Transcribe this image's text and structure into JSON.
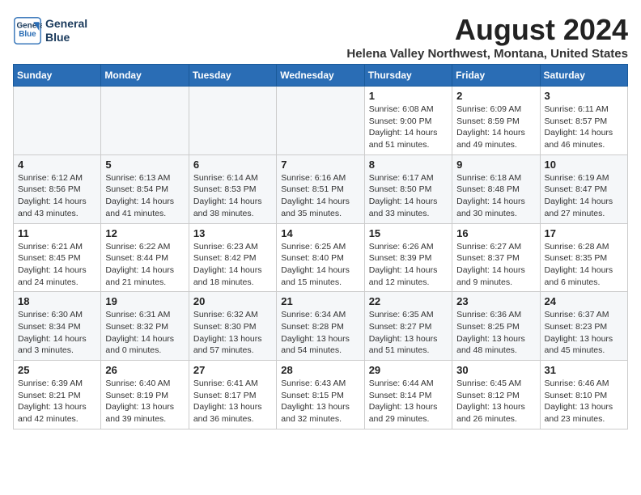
{
  "header": {
    "logo_line1": "General",
    "logo_line2": "Blue",
    "month_year": "August 2024",
    "location": "Helena Valley Northwest, Montana, United States"
  },
  "weekdays": [
    "Sunday",
    "Monday",
    "Tuesday",
    "Wednesday",
    "Thursday",
    "Friday",
    "Saturday"
  ],
  "weeks": [
    [
      {
        "day": "",
        "detail": ""
      },
      {
        "day": "",
        "detail": ""
      },
      {
        "day": "",
        "detail": ""
      },
      {
        "day": "",
        "detail": ""
      },
      {
        "day": "1",
        "detail": "Sunrise: 6:08 AM\nSunset: 9:00 PM\nDaylight: 14 hours\nand 51 minutes."
      },
      {
        "day": "2",
        "detail": "Sunrise: 6:09 AM\nSunset: 8:59 PM\nDaylight: 14 hours\nand 49 minutes."
      },
      {
        "day": "3",
        "detail": "Sunrise: 6:11 AM\nSunset: 8:57 PM\nDaylight: 14 hours\nand 46 minutes."
      }
    ],
    [
      {
        "day": "4",
        "detail": "Sunrise: 6:12 AM\nSunset: 8:56 PM\nDaylight: 14 hours\nand 43 minutes."
      },
      {
        "day": "5",
        "detail": "Sunrise: 6:13 AM\nSunset: 8:54 PM\nDaylight: 14 hours\nand 41 minutes."
      },
      {
        "day": "6",
        "detail": "Sunrise: 6:14 AM\nSunset: 8:53 PM\nDaylight: 14 hours\nand 38 minutes."
      },
      {
        "day": "7",
        "detail": "Sunrise: 6:16 AM\nSunset: 8:51 PM\nDaylight: 14 hours\nand 35 minutes."
      },
      {
        "day": "8",
        "detail": "Sunrise: 6:17 AM\nSunset: 8:50 PM\nDaylight: 14 hours\nand 33 minutes."
      },
      {
        "day": "9",
        "detail": "Sunrise: 6:18 AM\nSunset: 8:48 PM\nDaylight: 14 hours\nand 30 minutes."
      },
      {
        "day": "10",
        "detail": "Sunrise: 6:19 AM\nSunset: 8:47 PM\nDaylight: 14 hours\nand 27 minutes."
      }
    ],
    [
      {
        "day": "11",
        "detail": "Sunrise: 6:21 AM\nSunset: 8:45 PM\nDaylight: 14 hours\nand 24 minutes."
      },
      {
        "day": "12",
        "detail": "Sunrise: 6:22 AM\nSunset: 8:44 PM\nDaylight: 14 hours\nand 21 minutes."
      },
      {
        "day": "13",
        "detail": "Sunrise: 6:23 AM\nSunset: 8:42 PM\nDaylight: 14 hours\nand 18 minutes."
      },
      {
        "day": "14",
        "detail": "Sunrise: 6:25 AM\nSunset: 8:40 PM\nDaylight: 14 hours\nand 15 minutes."
      },
      {
        "day": "15",
        "detail": "Sunrise: 6:26 AM\nSunset: 8:39 PM\nDaylight: 14 hours\nand 12 minutes."
      },
      {
        "day": "16",
        "detail": "Sunrise: 6:27 AM\nSunset: 8:37 PM\nDaylight: 14 hours\nand 9 minutes."
      },
      {
        "day": "17",
        "detail": "Sunrise: 6:28 AM\nSunset: 8:35 PM\nDaylight: 14 hours\nand 6 minutes."
      }
    ],
    [
      {
        "day": "18",
        "detail": "Sunrise: 6:30 AM\nSunset: 8:34 PM\nDaylight: 14 hours\nand 3 minutes."
      },
      {
        "day": "19",
        "detail": "Sunrise: 6:31 AM\nSunset: 8:32 PM\nDaylight: 14 hours\nand 0 minutes."
      },
      {
        "day": "20",
        "detail": "Sunrise: 6:32 AM\nSunset: 8:30 PM\nDaylight: 13 hours\nand 57 minutes."
      },
      {
        "day": "21",
        "detail": "Sunrise: 6:34 AM\nSunset: 8:28 PM\nDaylight: 13 hours\nand 54 minutes."
      },
      {
        "day": "22",
        "detail": "Sunrise: 6:35 AM\nSunset: 8:27 PM\nDaylight: 13 hours\nand 51 minutes."
      },
      {
        "day": "23",
        "detail": "Sunrise: 6:36 AM\nSunset: 8:25 PM\nDaylight: 13 hours\nand 48 minutes."
      },
      {
        "day": "24",
        "detail": "Sunrise: 6:37 AM\nSunset: 8:23 PM\nDaylight: 13 hours\nand 45 minutes."
      }
    ],
    [
      {
        "day": "25",
        "detail": "Sunrise: 6:39 AM\nSunset: 8:21 PM\nDaylight: 13 hours\nand 42 minutes."
      },
      {
        "day": "26",
        "detail": "Sunrise: 6:40 AM\nSunset: 8:19 PM\nDaylight: 13 hours\nand 39 minutes."
      },
      {
        "day": "27",
        "detail": "Sunrise: 6:41 AM\nSunset: 8:17 PM\nDaylight: 13 hours\nand 36 minutes."
      },
      {
        "day": "28",
        "detail": "Sunrise: 6:43 AM\nSunset: 8:15 PM\nDaylight: 13 hours\nand 32 minutes."
      },
      {
        "day": "29",
        "detail": "Sunrise: 6:44 AM\nSunset: 8:14 PM\nDaylight: 13 hours\nand 29 minutes."
      },
      {
        "day": "30",
        "detail": "Sunrise: 6:45 AM\nSunset: 8:12 PM\nDaylight: 13 hours\nand 26 minutes."
      },
      {
        "day": "31",
        "detail": "Sunrise: 6:46 AM\nSunset: 8:10 PM\nDaylight: 13 hours\nand 23 minutes."
      }
    ]
  ]
}
